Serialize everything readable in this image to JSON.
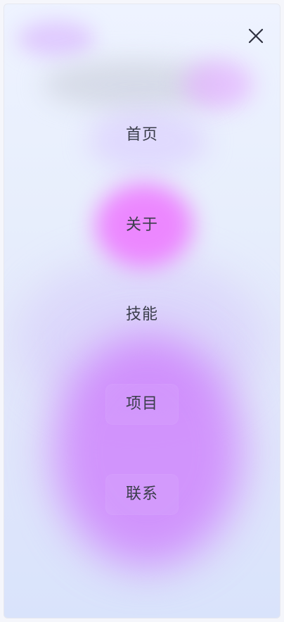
{
  "header": {
    "close_icon": "close-icon"
  },
  "menu": {
    "items": [
      {
        "label": "首页"
      },
      {
        "label": "关于"
      },
      {
        "label": "技能"
      },
      {
        "label": "项目"
      },
      {
        "label": "联系"
      }
    ],
    "active_index": 1
  },
  "colors": {
    "text": "#3a3d4a",
    "highlight": "#ec82ff",
    "background": "#e7eefc"
  }
}
